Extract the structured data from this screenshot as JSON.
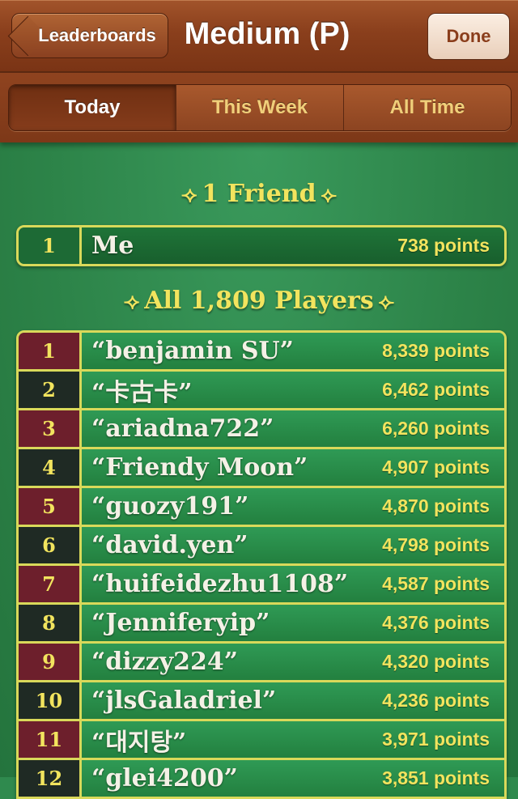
{
  "nav": {
    "back_label": "Leaderboards",
    "title": "Medium (P)",
    "done_label": "Done"
  },
  "tabs": [
    {
      "label": "Today",
      "active": true
    },
    {
      "label": "This Week",
      "active": false
    },
    {
      "label": "All Time",
      "active": false
    }
  ],
  "friends_section": {
    "heading": "1 Friend",
    "rows": [
      {
        "rank": "1",
        "name": "Me",
        "points": "738 points"
      }
    ]
  },
  "players_section": {
    "heading": "All 1,809 Players",
    "rows": [
      {
        "rank": "1",
        "name": "“benjamin SU”",
        "points": "8,339 points"
      },
      {
        "rank": "2",
        "name": "“卡古卡”",
        "points": "6,462 points"
      },
      {
        "rank": "3",
        "name": "“ariadna722”",
        "points": "6,260 points"
      },
      {
        "rank": "4",
        "name": "“Friendy Moon”",
        "points": "4,907 points"
      },
      {
        "rank": "5",
        "name": "“guozy191”",
        "points": "4,870 points"
      },
      {
        "rank": "6",
        "name": "“david.yen”",
        "points": "4,798 points"
      },
      {
        "rank": "7",
        "name": "“huifeidezhu1108”",
        "points": "4,587 points"
      },
      {
        "rank": "8",
        "name": "“Jenniferyip”",
        "points": "4,376 points"
      },
      {
        "rank": "9",
        "name": "“dizzy224”",
        "points": "4,320 points"
      },
      {
        "rank": "10",
        "name": "“jlsGaladriel”",
        "points": "4,236 points"
      },
      {
        "rank": "11",
        "name": "“대지탕”",
        "points": "3,971 points"
      },
      {
        "rank": "12",
        "name": "“glei4200”",
        "points": "3,851 points"
      }
    ]
  },
  "icons": {
    "header_ornament_left": "double-chevron-right-icon",
    "header_ornament_right": "double-chevron-left-icon"
  },
  "colors": {
    "felt_green": "#2d8449",
    "wood_brown": "#8a3f1c",
    "gold_text": "#f2e45e",
    "border_gold": "#d9d95a",
    "rank_maroon": "#6d1f2c",
    "rank_dark": "#1f2a24"
  }
}
